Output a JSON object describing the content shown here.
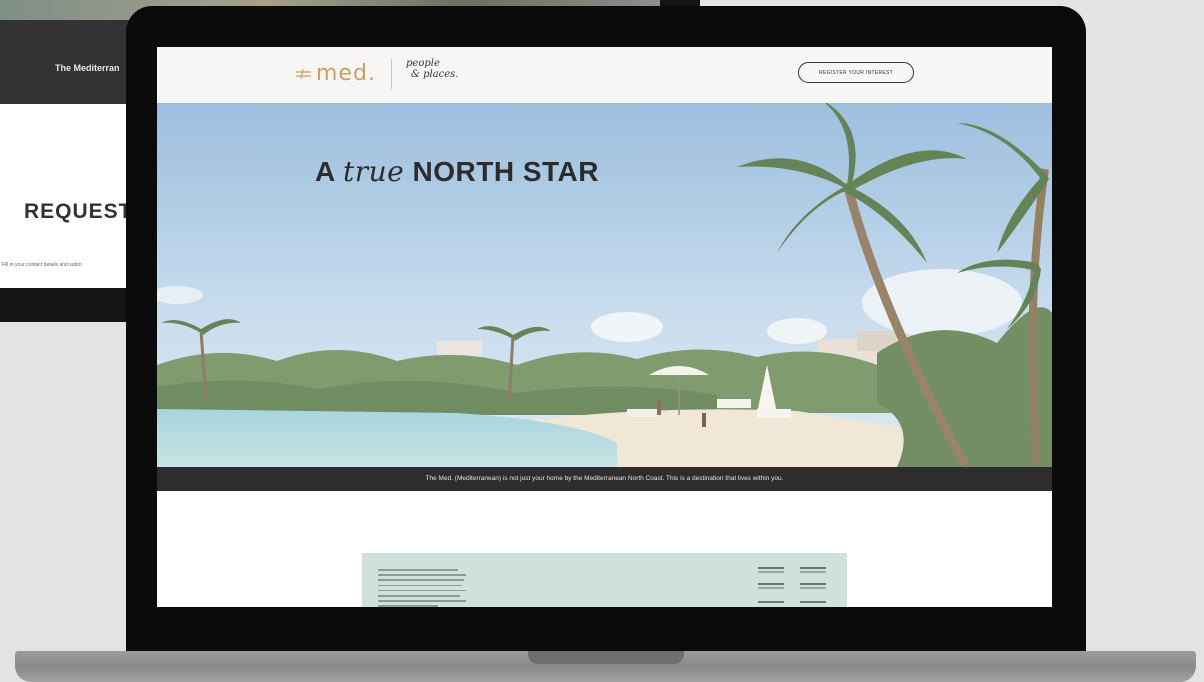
{
  "back_device": {
    "band_text": "The Mediterran",
    "heading": "REQUEST /",
    "subtext": "Fill in your contact details and subm"
  },
  "site": {
    "logo": {
      "mark": "med",
      "sep": ".",
      "people_line1": "people",
      "people_line2": "& places."
    },
    "nav": {
      "cta_label": "REGISTER YOUR INTEREST"
    },
    "hero": {
      "title_prefix": "A ",
      "title_italic": "true",
      "title_suffix": " NORTH STAR",
      "caption": "The Med. (Mediterranean) is not just your home by the Mediterranean North Coast. This is a destination that lives within you."
    },
    "colors": {
      "logo_gold": "#c9a06a",
      "dark_band": "#2d2d2d",
      "card_bg": "#cfe1dd"
    }
  },
  "icons": [
    "med-logo-icon"
  ]
}
